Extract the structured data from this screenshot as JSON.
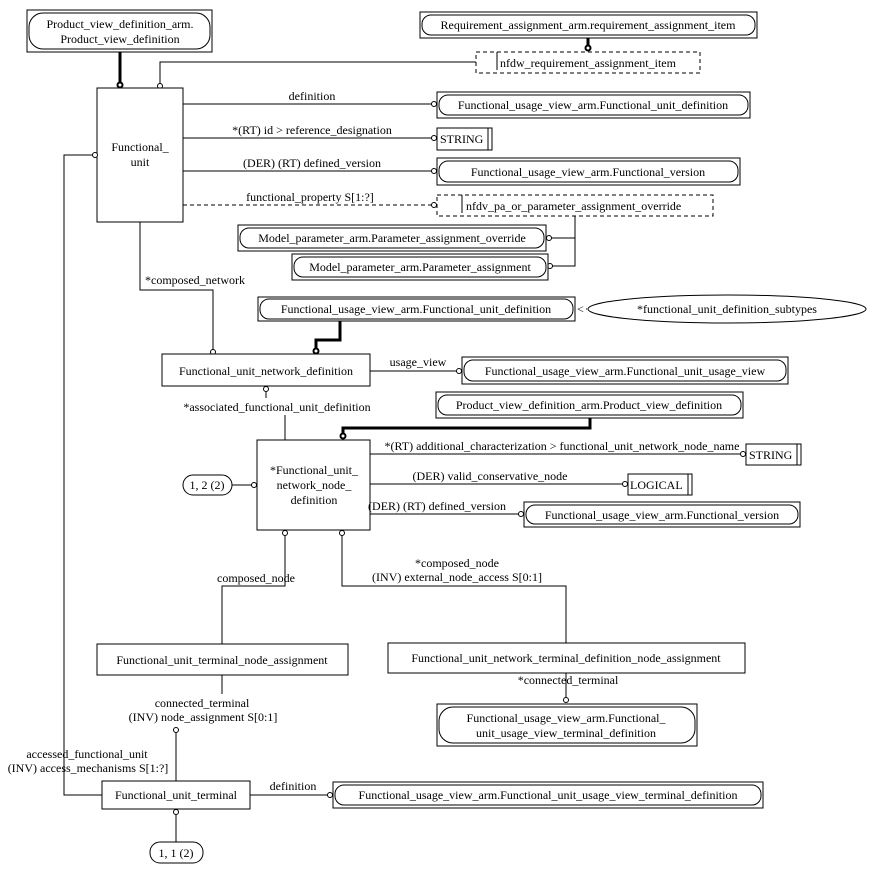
{
  "entities": {
    "pvd_top_line1": "Product_view_definition_arm.",
    "pvd_top_line2": "Product_view_definition",
    "req_item": "Requirement_assignment_arm.requirement_assignment_item",
    "nfdw_select": "nfdw_requirement_assignment_item",
    "functional_unit_line1": "Functional_",
    "functional_unit_line2": "unit",
    "fud_ref": "Functional_usage_view_arm.Functional_unit_definition",
    "string1": "STRING",
    "fv_ref1": "Functional_usage_view_arm.Functional_version",
    "nfdv_select": "nfdv_pa_or_parameter_assignment_override",
    "pao_ref": "Model_parameter_arm.Parameter_assignment_override",
    "pa_ref": "Model_parameter_arm.Parameter_assignment",
    "fud_super": "Functional_usage_view_arm.Functional_unit_definition",
    "subtypes": "*functional_unit_definition_subtypes",
    "fund": "Functional_unit_network_definition",
    "fuuv_ref": "Functional_usage_view_arm.Functional_unit_usage_view",
    "pvd_ref2": "Product_view_definition_arm.Product_view_definition",
    "node_line1": "*Functional_unit_",
    "node_line2": "network_node_",
    "node_line3": "definition",
    "page_ref1": "1, 2 (2)",
    "string2": "STRING",
    "logical": "LOGICAL",
    "fv_ref2": "Functional_usage_view_arm.Functional_version",
    "futna": "Functional_unit_terminal_node_assignment",
    "funtdna": "Functional_unit_network_terminal_definition_node_assignment",
    "fuuvtd_line1": "Functional_usage_view_arm.Functional_",
    "fuuvtd_line2": "unit_usage_view_terminal_definition",
    "fut": "Functional_unit_terminal",
    "fuuvtd_ref": "Functional_usage_view_arm.Functional_unit_usage_view_terminal_definition",
    "page_ref2": "1, 1 (2)"
  },
  "relations": {
    "definition": "definition",
    "id": "*(RT) id > reference_designation",
    "defined_version1": "(DER) (RT) defined_version",
    "functional_property": "functional_property S[1:?]",
    "composed_network": "*composed_network",
    "usage_view": "usage_view",
    "associated": "*associated_functional_unit_definition",
    "additional": "*(RT) additional_characterization > functional_unit_network_node_name",
    "valid": "(DER) valid_conservative_node",
    "defined_version2": "(DER) (RT) defined_version",
    "composed_node": "composed_node",
    "composed_node2": "*composed_node",
    "external": "(INV) external_node_access S[0:1]",
    "connected_terminal1": "*connected_terminal",
    "connected_terminal2": "connected_terminal",
    "node_assignment": "(INV) node_assignment S[0:1]",
    "accessed": "accessed_functional_unit",
    "access_mech": "(INV) access_mechanisms S[1:?]",
    "definition2": "definition"
  }
}
